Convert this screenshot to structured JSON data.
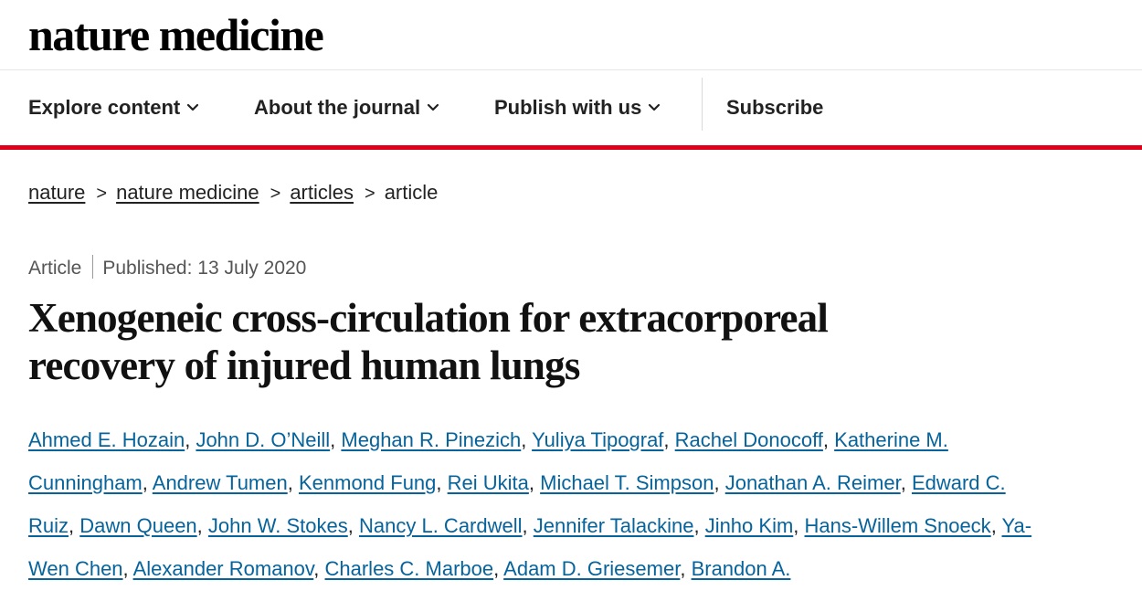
{
  "site": {
    "logo": "nature medicine"
  },
  "nav": {
    "items": [
      {
        "label": "Explore content",
        "has_dropdown": true
      },
      {
        "label": "About the journal",
        "has_dropdown": true
      },
      {
        "label": "Publish with us",
        "has_dropdown": true
      },
      {
        "label": "Subscribe",
        "has_dropdown": false
      }
    ],
    "accent_color": "#e0001a"
  },
  "breadcrumb": {
    "items": [
      "nature",
      "nature medicine",
      "articles"
    ],
    "current": "article",
    "separator": ">"
  },
  "article": {
    "type": "Article",
    "published": "Published: 13 July 2020",
    "title_line1": "Xenogeneic cross-circulation for extracorporeal",
    "title_line2": "recovery of injured human lungs",
    "authors": [
      "Ahmed E. Hozain",
      "John D. O’Neill",
      "Meghan R. Pinezich",
      "Yuliya Tipograf",
      "Rachel Donocoff",
      "Katherine M. Cunningham",
      "Andrew Tumen",
      "Kenmond Fung",
      "Rei Ukita",
      "Michael T. Simpson",
      "Jonathan A. Reimer",
      "Edward C. Ruiz",
      "Dawn Queen",
      "John W. Stokes",
      "Nancy L. Cardwell",
      "Jennifer Talackine",
      "Jinho Kim",
      "Hans-Willem Snoeck",
      "Ya-Wen Chen",
      "Alexander Romanov",
      "Charles C. Marboe",
      "Adam D. Griesemer",
      "Brandon A."
    ],
    "author_link_color": "#06639b"
  }
}
